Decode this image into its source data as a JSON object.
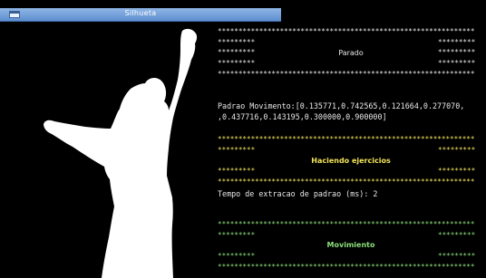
{
  "window": {
    "title": "Silhueta"
  },
  "colors": {
    "titlebar": "#6f9ad8",
    "default_text": "#e8e8e8",
    "exercising_text": "#f2e45c",
    "movement_text": "#8de07a",
    "silhouette": "#ffffff",
    "background": "#000000"
  },
  "icons": {
    "window_icon": "window-icon"
  },
  "console": {
    "stopped_block": {
      "border": "**************************************************************",
      "short_stars": "*********",
      "label": "Parado"
    },
    "pattern_line_1": "Padrao Movimento:[0.135771,0.742565,0.121664,0.277070,",
    "pattern_line_2": ",0.437716,0.143195,0.300000,0.900000]",
    "exercising_block": {
      "border": "**************************************************************",
      "short_stars": "*********",
      "label": "Haciendo ejercicios"
    },
    "extraction_time": "Tempo de extracao de padrao (ms): 2",
    "movement_block": {
      "border": "**************************************************************",
      "short_stars": "*********",
      "label": "Movimiento"
    }
  }
}
